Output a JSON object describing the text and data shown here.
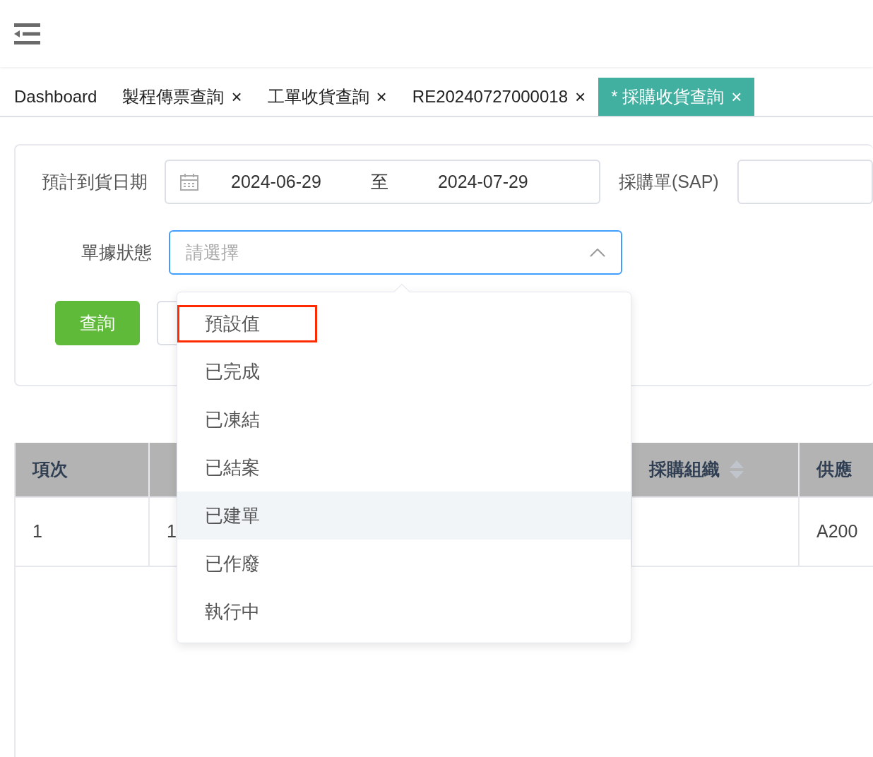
{
  "tabs": [
    {
      "label": "Dashboard",
      "closable": false,
      "selected": false
    },
    {
      "label": "製程傳票查詢",
      "closable": true,
      "selected": false
    },
    {
      "label": "工單收貨查詢",
      "closable": true,
      "selected": false
    },
    {
      "label": "RE20240727000018",
      "closable": true,
      "selected": false
    },
    {
      "label": "* 採購收貨查詢",
      "closable": true,
      "selected": true
    }
  ],
  "close_glyph": "×",
  "form": {
    "date_label": "預計到貨日期",
    "date_from": "2024-06-29",
    "date_sep": "至",
    "date_to": "2024-07-29",
    "po_label": "採購單(SAP)",
    "status_label": "單據狀態",
    "status_placeholder": "請選擇",
    "status_open": true,
    "search_button": "查詢"
  },
  "dropdown": {
    "options": [
      {
        "label": "預設值",
        "highlighted": true,
        "hovered": false
      },
      {
        "label": "已完成",
        "highlighted": false,
        "hovered": false
      },
      {
        "label": "已凍結",
        "highlighted": false,
        "hovered": false
      },
      {
        "label": "已結案",
        "highlighted": false,
        "hovered": false
      },
      {
        "label": "已建單",
        "highlighted": false,
        "hovered": true
      },
      {
        "label": "已作廢",
        "highlighted": false,
        "hovered": false
      },
      {
        "label": "執行中",
        "highlighted": false,
        "hovered": false
      }
    ]
  },
  "table": {
    "columns": [
      {
        "label": "項次",
        "sortable": false
      },
      {
        "sortable": false
      },
      {
        "label": "採購組織",
        "sortable": true
      },
      {
        "label": "供應",
        "sortable": false
      }
    ],
    "rows": [
      [
        "1",
        "1",
        null,
        "A200"
      ]
    ]
  }
}
